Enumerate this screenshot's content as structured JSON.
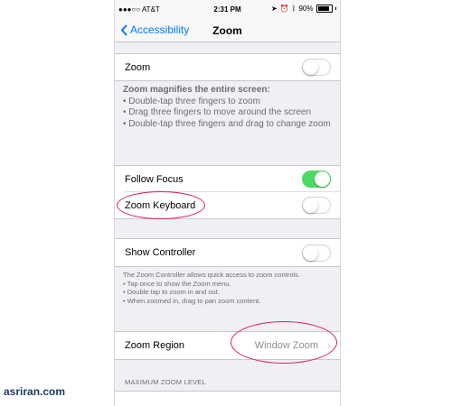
{
  "status_bar": {
    "carrier": "●●●○○ AT&T",
    "time": "2:31 PM",
    "battery": "90%",
    "battery_level": 0.9
  },
  "nav": {
    "back_label": "Accessibility",
    "title": "Zoom"
  },
  "zoom_row": {
    "label": "Zoom",
    "on": false
  },
  "zoom_description": {
    "title": "Zoom magnifies the entire screen:",
    "bullets": [
      "• Double-tap three fingers to zoom",
      "• Drag three fingers to move around the screen",
      "• Double-tap three fingers and drag to change zoom"
    ]
  },
  "follow_focus": {
    "label": "Follow Focus",
    "on": true
  },
  "zoom_keyboard": {
    "label": "Zoom Keyboard",
    "on": false
  },
  "show_controller": {
    "label": "Show Controller",
    "on": false
  },
  "controller_description": {
    "title": "The Zoom Controller allows quick access to zoom controls.",
    "bullets": [
      "• Tap once to show the Zoom menu.",
      "• Double tap to zoom in and out.",
      "• When zoomed in, drag to pan zoom content."
    ]
  },
  "zoom_region": {
    "label": "Zoom Region",
    "value": "Window Zoom"
  },
  "max_zoom": {
    "header": "MAXIMUM ZOOM LEVEL"
  },
  "watermark": "asriran.com",
  "colors": {
    "accent": "#007aff",
    "toggle_on": "#4cd964",
    "highlight": "#d81b60"
  }
}
